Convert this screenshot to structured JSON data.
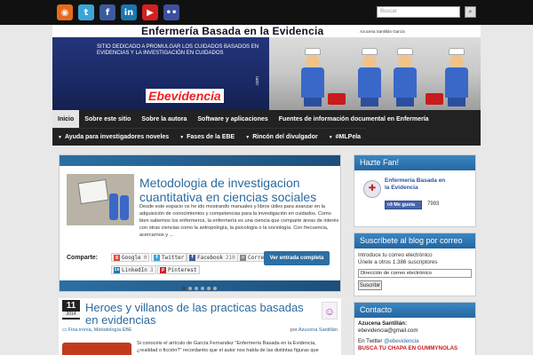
{
  "topbar": {
    "social": [
      {
        "name": "rss-icon",
        "glyph": "◉",
        "color": "#e76a1c"
      },
      {
        "name": "twitter-icon",
        "glyph": "t",
        "color": "#3aa6d8"
      },
      {
        "name": "facebook-icon",
        "glyph": "f",
        "color": "#3b5b9c"
      },
      {
        "name": "linkedin-icon",
        "glyph": "in",
        "color": "#1a77b0"
      },
      {
        "name": "youtube-icon",
        "glyph": "▶",
        "color": "#d32020"
      },
      {
        "name": "flickr-icon",
        "glyph": "••",
        "color": "#3f4f9f"
      }
    ],
    "search_placeholder": "Buscar"
  },
  "header": {
    "title": "Enfermería Basada en la Evidencia",
    "author": "Azucena Santillán García",
    "tagline": "Sitio dedicado a promulgar los CUIDADOS BASADOS EN EVIDENCIAS y la INVESTIGACIÓN EN CUIDADOS",
    "logo": "Ebevidencia",
    "logo_suffix": ".com"
  },
  "nav": {
    "row1": [
      "Inicio",
      "Sobre este sitio",
      "Sobre la autora",
      "Software y aplicaciones",
      "Fuentes de información documental en Enfermería"
    ],
    "row2": [
      "Ayuda para investigadores noveles",
      "Fases de la EBE",
      "Rincón del divulgador",
      "#MLPela"
    ]
  },
  "featured": {
    "title": "Metodologia de investigacion cuantitativa en ciencias sociales",
    "excerpt": "Desde este espacio os he ido mostrando manuales y libros útiles para avanzar en la adquisición de conocimientos y competencias para la investigación en cuidados. Como bien sabemos los enfermeros, la enfermería es una ciencia que comparte áreas de interés con otras ciencias como la antropología, la psicología o la sociología. Con frecuencia, acercarnos y ...",
    "share_label": "Comparte:",
    "share": {
      "google": {
        "label": "Google",
        "count": "0"
      },
      "twitter": {
        "label": "Twitter"
      },
      "facebook": {
        "label": "Facebook",
        "count": "210"
      },
      "correo": {
        "label": "Corre"
      },
      "linkedin": {
        "label": "LinkedIn",
        "count": "3"
      },
      "pinterest": {
        "label": "Pinterest"
      }
    },
    "read_more": "Ver entrada completa"
  },
  "post": {
    "date_day": "11",
    "date_year": "2014",
    "title": "Heroes y villanos de las practicas basadas en evidencias",
    "categories": "Fina ironía, Metodología EBE",
    "by": "por",
    "author": "Azucena Santillán",
    "excerpt": "Si conocéis el artículo de García Fernandez \"Enfermería Basada en la Evidencia, ¿realidad o ficción?\" recordaréis que el autor nos habla de las distintas figuras que"
  },
  "sidebar": {
    "fan": {
      "title": "Hazte Fan!",
      "page_name": "Enfermería Basada en la Evidencia",
      "like_label": "Me gusta",
      "like_count": "7993"
    },
    "subscribe": {
      "title": "Suscríbete al blog por correo",
      "text": "Introduce tu correo electrónico",
      "join_text": "Únete a otros 1.386 suscriptores",
      "input_value": "Dirección de correo electrónico",
      "button": "Suscribir"
    },
    "contact": {
      "title": "Contacto",
      "name": "Azucena Santillán:",
      "email": "ebevidencia@gmail.com",
      "twitter_prefix": "En Twitter",
      "twitter_handle": "@ebevidencia",
      "gummy": "BUSCA TU CHAPA EN GUMMYNOLAS"
    }
  }
}
